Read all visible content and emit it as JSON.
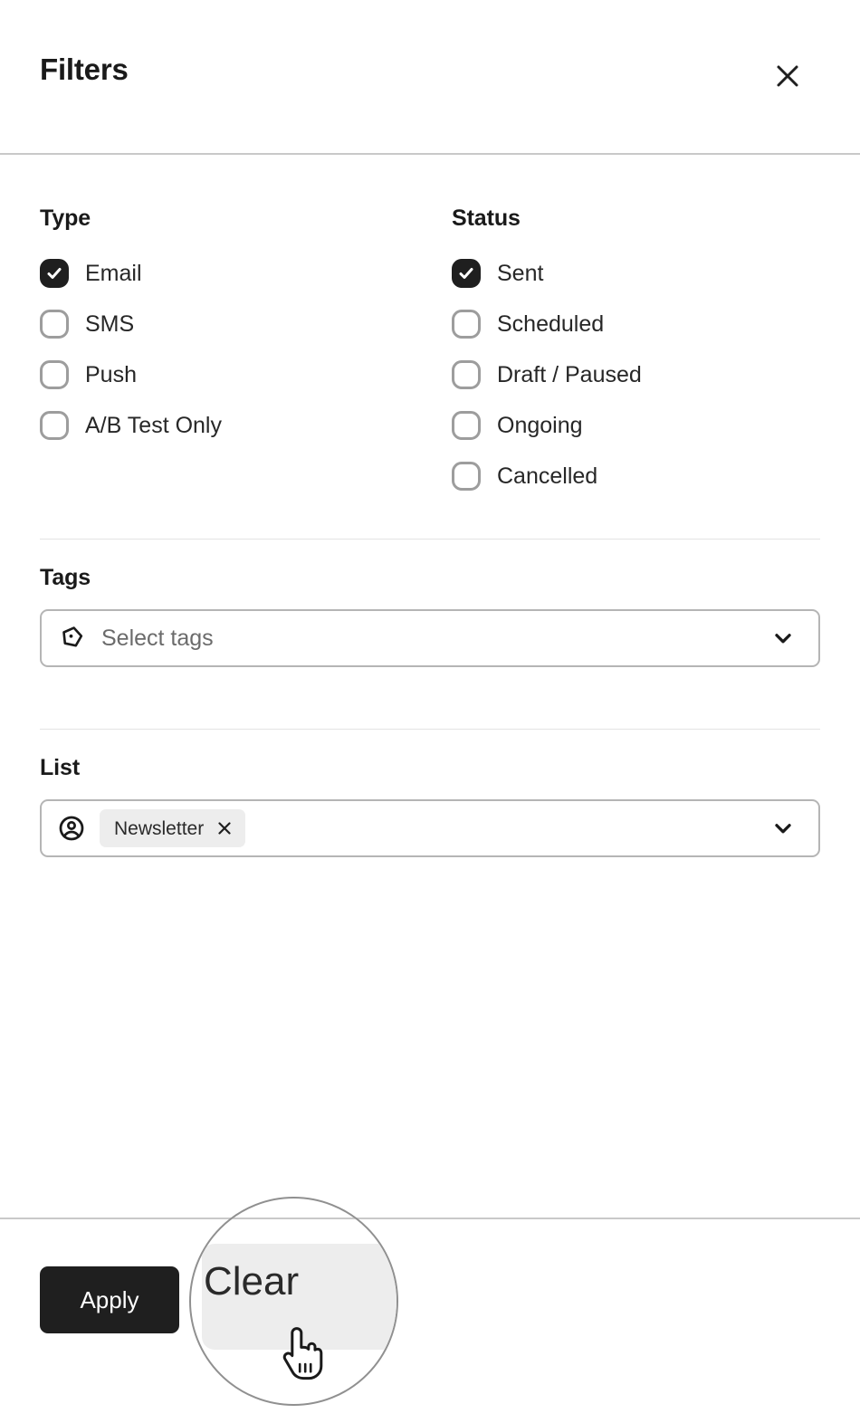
{
  "header": {
    "title": "Filters",
    "close_icon": "close-icon"
  },
  "type_group": {
    "heading": "Type",
    "options": [
      {
        "label": "Email",
        "checked": true
      },
      {
        "label": "SMS",
        "checked": false
      },
      {
        "label": "Push",
        "checked": false
      },
      {
        "label": "A/B Test Only",
        "checked": false
      }
    ]
  },
  "status_group": {
    "heading": "Status",
    "options": [
      {
        "label": "Sent",
        "checked": true
      },
      {
        "label": "Scheduled",
        "checked": false
      },
      {
        "label": "Draft / Paused",
        "checked": false
      },
      {
        "label": "Ongoing",
        "checked": false
      },
      {
        "label": "Cancelled",
        "checked": false
      }
    ]
  },
  "tags_field": {
    "heading": "Tags",
    "icon": "tag-icon",
    "placeholder": "Select tags",
    "value": "",
    "chevron_icon": "chevron-down-icon"
  },
  "list_field": {
    "heading": "List",
    "icon": "user-circle-icon",
    "placeholder": "",
    "chips": [
      {
        "label": "Newsletter",
        "remove_icon": "chip-remove-icon"
      }
    ],
    "chevron_icon": "chevron-down-icon"
  },
  "footer": {
    "apply_label": "Apply",
    "clear_label": "Clear"
  },
  "magnifier": {
    "target_label": "Clear",
    "cursor_icon": "pointer-hand-cursor"
  },
  "colors": {
    "accent": "#1f1f1f",
    "panel_bg": "#ffffff",
    "border": "#b5b5b5",
    "divider": "#c9c9c9",
    "chip_bg": "#ededed",
    "muted_text": "#6b6b6b"
  }
}
